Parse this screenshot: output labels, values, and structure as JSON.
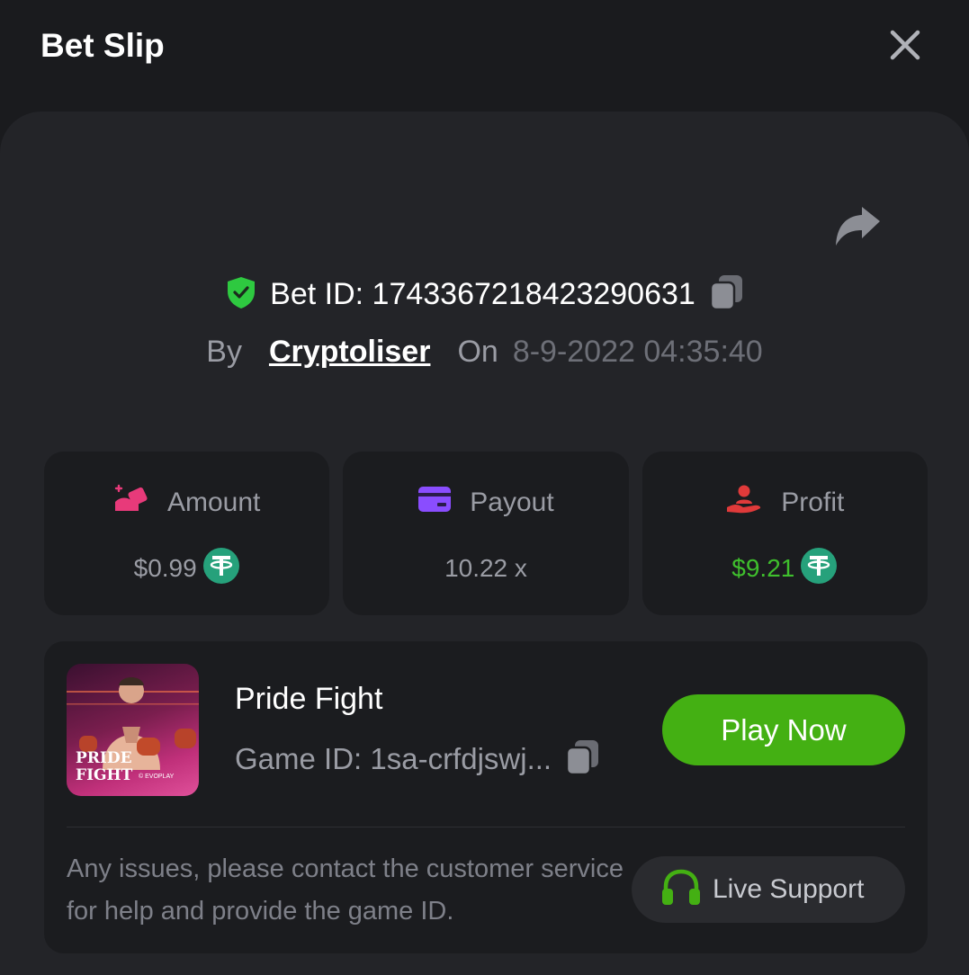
{
  "header": {
    "title": "Bet Slip"
  },
  "bet": {
    "id_label": "Bet ID:",
    "id_value": "1743367218423290631",
    "by_label": "By",
    "user": "Cryptoliser",
    "on_label": "On",
    "datetime": "8-9-2022 04:35:40"
  },
  "stats": {
    "amount": {
      "label": "Amount",
      "value": "$0.99"
    },
    "payout": {
      "label": "Payout",
      "value": "10.22 x"
    },
    "profit": {
      "label": "Profit",
      "value": "$9.21"
    }
  },
  "game": {
    "thumb_line1": "PRIDE",
    "thumb_line2": "FIGHT",
    "thumb_brand": "© EVOPLAY",
    "name": "Pride Fight",
    "id_text": "Game ID: 1sa-crfdjswj...",
    "play_label": "Play Now",
    "help_text": "Any issues, please contact the customer service for help and provide the game ID.",
    "support_label": "Live Support"
  },
  "colors": {
    "accent_green": "#44b013",
    "profit_green": "#3fbf2d",
    "shield_green": "#2ec940",
    "amount_icon": "#e83a7a",
    "payout_icon": "#8a4dff",
    "profit_icon": "#e03a3a",
    "tether": "#26a17b"
  },
  "icons": {
    "close": "close-icon",
    "share": "share-arrow-icon",
    "shield": "shield-check-icon",
    "copy": "copy-icon",
    "amount": "wallet-hand-icon",
    "payout": "card-icon",
    "profit": "profit-hand-icon",
    "coin": "tether-icon",
    "support": "headset-icon"
  }
}
